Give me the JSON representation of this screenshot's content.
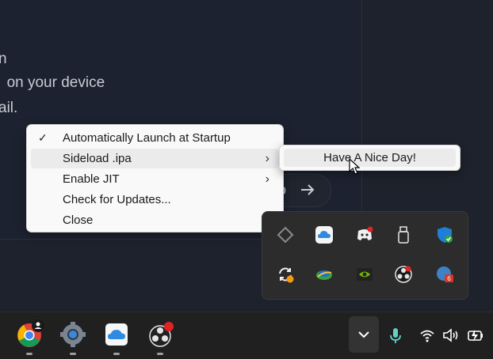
{
  "background": {
    "line1": "n",
    "line2": "on your device",
    "line3": "ail.",
    "pill_text": "o"
  },
  "context_menu": {
    "items": [
      {
        "label": "Automatically Launch at Startup",
        "checked": true,
        "submenu": false
      },
      {
        "label": "Sideload .ipa",
        "checked": false,
        "submenu": true
      },
      {
        "label": "Enable JIT",
        "checked": false,
        "submenu": true
      },
      {
        "label": "Check for Updates...",
        "checked": false,
        "submenu": false
      },
      {
        "label": "Close",
        "checked": false,
        "submenu": false
      }
    ],
    "checkmark": "✓",
    "chevron": "›"
  },
  "submenu": {
    "items": [
      {
        "label": "Have A Nice Day!"
      }
    ]
  },
  "tray": {
    "icons": [
      "altserver-diamond-icon",
      "icloud-icon",
      "discord-icon",
      "usb-drive-icon",
      "windows-security-icon",
      "sync-icon",
      "globe-app-icon",
      "nvidia-icon",
      "obs-icon",
      "app-badge-icon"
    ],
    "badge_number": "6"
  },
  "taskbar": {
    "apps": [
      "chrome-icon",
      "settings-icon",
      "icloud-icon",
      "obs-icon"
    ]
  }
}
